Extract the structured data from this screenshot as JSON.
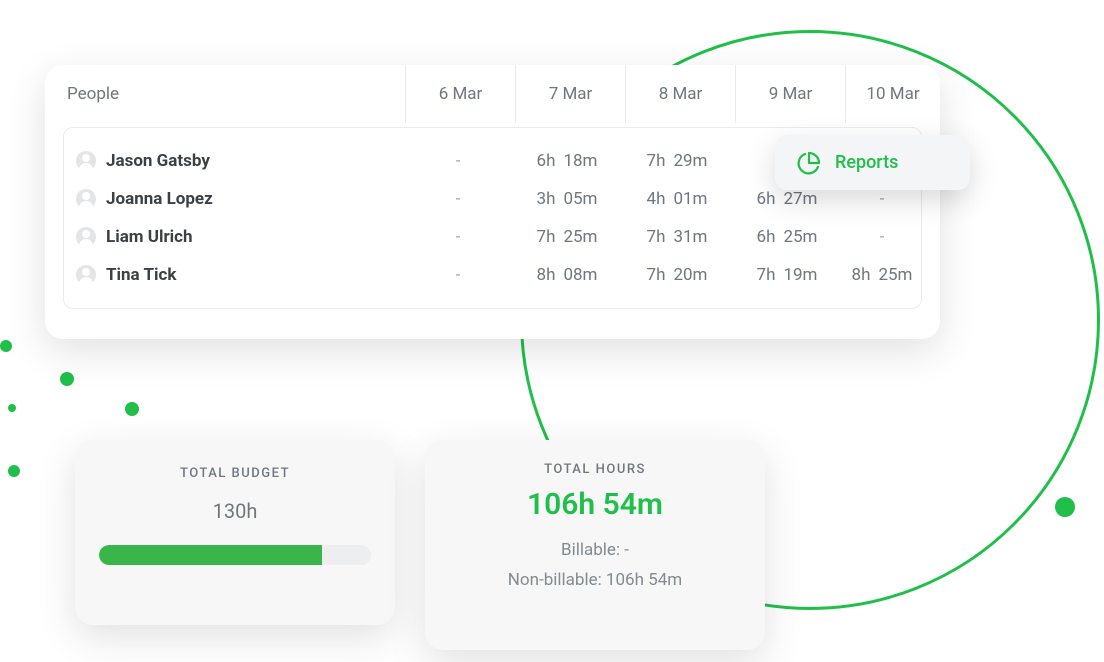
{
  "table": {
    "people_label": "People",
    "dates": [
      "6 Mar",
      "7 Mar",
      "8 Mar",
      "9 Mar",
      "10 Mar"
    ],
    "rows": [
      {
        "name": "Jason Gatsby",
        "times": [
          "-",
          "6h 18m",
          "7h 29m",
          "",
          ""
        ]
      },
      {
        "name": "Joanna Lopez",
        "times": [
          "-",
          "3h 05m",
          "4h 01m",
          "6h 27m",
          "-"
        ]
      },
      {
        "name": "Liam Ulrich",
        "times": [
          "-",
          "7h 25m",
          "7h 31m",
          "6h 25m",
          "-"
        ]
      },
      {
        "name": "Tina Tick",
        "times": [
          "-",
          "8h 08m",
          "7h 20m",
          "7h 19m",
          "8h 25m"
        ]
      }
    ]
  },
  "reports": {
    "label": "Reports"
  },
  "budget": {
    "title": "TOTAL BUDGET",
    "value": "130h",
    "progress_pct": 82
  },
  "hours": {
    "title": "TOTAL HOURS",
    "value": "106h 54m",
    "billable_label": "Billable: -",
    "nonbillable_label": "Non-billable: 106h 54m"
  }
}
